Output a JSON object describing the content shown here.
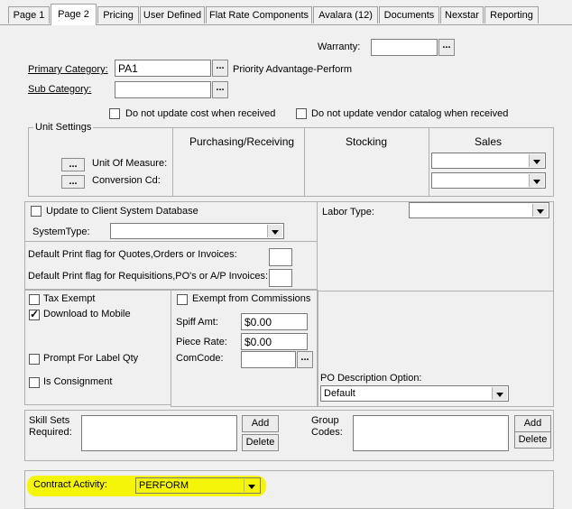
{
  "tabs": [
    "Page 1",
    "Page 2",
    "Pricing",
    "User Defined",
    "Flat Rate Components",
    "Avalara (12)",
    "Documents",
    "Nexstar",
    "Reporting"
  ],
  "active_tab": "Page 2",
  "highlight_color": "#f5f50a",
  "warranty": {
    "label": "Warranty:",
    "value": ""
  },
  "primary_category": {
    "label": "Primary Category:",
    "value": "PA1",
    "description": "Priority Advantage-Perform"
  },
  "sub_category": {
    "label": "Sub Category:",
    "value": ""
  },
  "no_update_cost": {
    "label": "Do not update cost when received",
    "checked": false
  },
  "no_update_vendor": {
    "label": "Do not update vendor catalog when received",
    "checked": false
  },
  "unit_settings": {
    "title": "Unit Settings",
    "unit_of_measure": "Unit Of Measure:",
    "conversion_cd": "Conversion Cd:",
    "purchasing": "Purchasing/Receiving",
    "stocking": "Stocking",
    "sales": "Sales",
    "sales_uom": "",
    "sales_conv": ""
  },
  "update_client": {
    "label": "Update to Client System Database",
    "checked": false
  },
  "system_type": {
    "label": "SystemType:",
    "value": ""
  },
  "labor_type": {
    "label": "Labor Type:",
    "value": ""
  },
  "print_flag_quotes": "Default Print flag for Quotes,Orders or Invoices:",
  "print_flag_requisitions": "Default Print flag for Requisitions,PO's or A/P Invoices:",
  "tax_exempt": {
    "label": "Tax Exempt",
    "checked": false
  },
  "download_mobile": {
    "label": "Download to Mobile",
    "checked": true
  },
  "prompt_label": {
    "label": "Prompt For Label Qty",
    "checked": false
  },
  "is_consignment": {
    "label": "Is Consignment",
    "checked": false
  },
  "exempt_commissions": {
    "label": "Exempt from Commissions",
    "checked": false
  },
  "spiff_amt": {
    "label": "Spiff Amt:",
    "value": "$0.00"
  },
  "piece_rate": {
    "label": "Piece Rate:",
    "value": "$0.00"
  },
  "comcode": {
    "label": "ComCode:",
    "value": ""
  },
  "po_desc": {
    "label": "PO Description Option:",
    "value": "Default"
  },
  "skill_sets": {
    "label_line1": "Skill Sets",
    "label_line2": "Required:",
    "add": "Add",
    "delete": "Delete"
  },
  "group_codes": {
    "label_line1": "Group",
    "label_line2": "Codes:",
    "add": "Add",
    "delete": "Delete"
  },
  "contract_activity": {
    "label": "Contract Activity:",
    "value": "PERFORM"
  },
  "ellipsis": "..."
}
